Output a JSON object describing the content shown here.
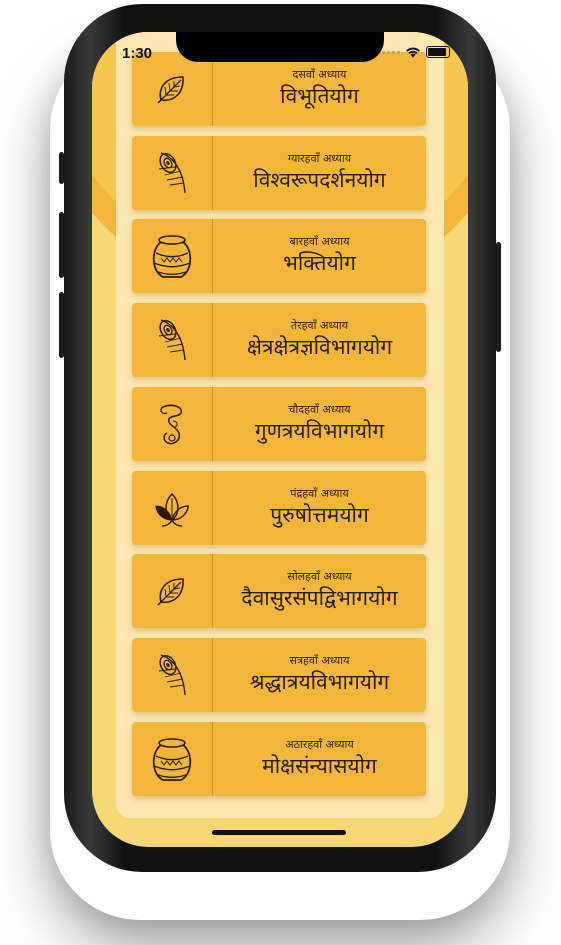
{
  "status_bar": {
    "time": "1:30"
  },
  "chapters": [
    {
      "label": "दसवाँ अध्याय",
      "title": "विभूतियोग",
      "icon": "leaf-icon"
    },
    {
      "label": "ग्यारहवाँ अध्याय",
      "title": "विश्वरूपदर्शनयोग",
      "icon": "peacock-feather-icon"
    },
    {
      "label": "बारहवाँ अध्याय",
      "title": "भक्तियोग",
      "icon": "pot-icon"
    },
    {
      "label": "तेरहवाँ अध्याय",
      "title": "क्षेत्रक्षेत्रज्ञविभागयोग",
      "icon": "peacock-feather-icon"
    },
    {
      "label": "चौदहवाँ अध्याय",
      "title": "गुणत्रयविभागयोग",
      "icon": "conch-icon"
    },
    {
      "label": "पंद्रहवाँ अध्याय",
      "title": "पुरुषोत्तमयोग",
      "icon": "lotus-icon"
    },
    {
      "label": "सोलहवाँ अध्याय",
      "title": "दैवासुरसंपद्विभागयोग",
      "icon": "leaf-icon"
    },
    {
      "label": "सत्रहवाँ अध्याय",
      "title": "श्रद्धात्रयविभागयोग",
      "icon": "peacock-feather-icon"
    },
    {
      "label": "अठारहवाँ अध्याय",
      "title": "मोक्षसंन्यासयोग",
      "icon": "pot-icon"
    }
  ],
  "colors": {
    "card": "#f2b73a",
    "panel": "#fbe7b1",
    "background": "#f6d775",
    "text": "#2a1d08"
  }
}
